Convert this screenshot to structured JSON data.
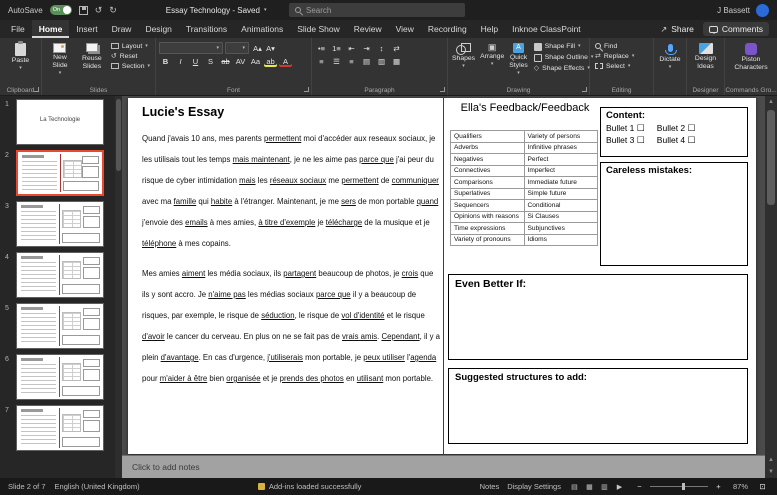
{
  "colors": {
    "accent_selection_red": "#e8492f",
    "slide_separator_red": "#8b1f1f",
    "titlebar_bg": "#1f1f1f",
    "ribbon_bg": "#333333",
    "canvas_bg": "#4b4b4b"
  },
  "titlebar": {
    "autosave_label": "AutoSave",
    "autosave_state": "On",
    "title": "Essay Technology - Saved",
    "search_placeholder": "Search",
    "user_name": "J Bassett"
  },
  "tabs": {
    "items": [
      "File",
      "Home",
      "Insert",
      "Draw",
      "Design",
      "Transitions",
      "Animations",
      "Slide Show",
      "Review",
      "View",
      "Recording",
      "Help",
      "Inknoe ClassPoint"
    ],
    "active": "Home",
    "share": "Share",
    "comments": "Comments"
  },
  "ribbon": {
    "paste": {
      "label": "Paste",
      "group": "Clipboard"
    },
    "slides": {
      "new_slide": "New Slide",
      "reuse_slides": "Reuse Slides",
      "layout": "Layout",
      "reset": "Reset",
      "section": "Section",
      "group": "Slides"
    },
    "font": {
      "group": "Font",
      "row1_buttons": [
        "grow-font",
        "shrink-font"
      ],
      "buttons": [
        "bold",
        "italic",
        "underline",
        "shadow",
        "strikethrough",
        "character-spacing",
        "change-case",
        "highlight-color",
        "font-color"
      ]
    },
    "paragraph": {
      "group": "Paragraph",
      "row1": [
        "bullets",
        "numbering",
        "indent-decrease",
        "indent-increase",
        "line-spacing",
        "text-direction"
      ],
      "row2": [
        "align-left",
        "align-center",
        "align-right",
        "justify",
        "columns",
        "convert-to-smartart"
      ]
    },
    "drawing": {
      "group": "Drawing",
      "shapes": "Shapes",
      "arrange": "Arrange",
      "quick_styles": "Quick Styles",
      "shape_fill": "Shape Fill",
      "shape_outline": "Shape Outline",
      "shape_effects": "Shape Effects"
    },
    "editing": {
      "group": "Editing",
      "find": "Find",
      "replace": "Replace",
      "select": "Select"
    },
    "voice": {
      "dictate": "Dictate"
    },
    "designer": {
      "label": "Design Ideas",
      "group": "Designer"
    },
    "classpoint": {
      "label": "Piston Characters",
      "group": "Commands Gro..."
    }
  },
  "slide_panel": {
    "selected": 2,
    "slides": [
      {
        "n": 1,
        "title": "La Technologie"
      },
      {
        "n": 2
      },
      {
        "n": 3
      },
      {
        "n": 4
      },
      {
        "n": 5
      },
      {
        "n": 6
      },
      {
        "n": 7
      }
    ]
  },
  "slide": {
    "essay_title": "Lucie's Essay",
    "paragraphs": [
      [
        {
          "t": "Quand j'avais 10 ans, mes parents "
        },
        {
          "t": "permettent",
          "u": true
        },
        {
          "t": " moi d'accéder aux reseaux sociaux, je les utilisais tout les temps "
        },
        {
          "t": "mais maintenant",
          "u": true
        },
        {
          "t": ", je ne les aime pas "
        },
        {
          "t": "parce que",
          "u": true
        },
        {
          "t": " j'ai peur du risque de cyber intimidation "
        },
        {
          "t": "mais",
          "u": true
        },
        {
          "t": " les "
        },
        {
          "t": "réseaux sociaux",
          "u": true
        },
        {
          "t": " me "
        },
        {
          "t": "permettent",
          "u": true
        },
        {
          "t": " de "
        },
        {
          "t": "communiquer",
          "u": true
        },
        {
          "t": " avec ma "
        },
        {
          "t": "famille",
          "u": true
        },
        {
          "t": " qui "
        },
        {
          "t": "habite",
          "u": true
        },
        {
          "t": " à l'étranger.  Maintenant, je me "
        },
        {
          "t": "sers",
          "u": true
        },
        {
          "t": " de mon portable "
        },
        {
          "t": "quand",
          "u": true
        },
        {
          "t": " j'envoie des "
        },
        {
          "t": "emails",
          "u": true
        },
        {
          "t": " à mes amies, "
        },
        {
          "t": "à titre d'exemple",
          "u": true
        },
        {
          "t": " je "
        },
        {
          "t": "télécharge",
          "u": true
        },
        {
          "t": " de la musique et je "
        },
        {
          "t": "téléphone",
          "u": true
        },
        {
          "t": " à mes copains."
        }
      ],
      [
        {
          "t": "Mes amies "
        },
        {
          "t": "aiment",
          "u": true
        },
        {
          "t": " les média sociaux, ils "
        },
        {
          "t": "partagent",
          "u": true
        },
        {
          "t": " beaucoup de photos, je "
        },
        {
          "t": "crois",
          "u": true
        },
        {
          "t": " que ils y sont accro. Je "
        },
        {
          "t": "n'aime pas",
          "u": true
        },
        {
          "t": " les médias sociaux "
        },
        {
          "t": "parce que",
          "u": true
        },
        {
          "t": " il y a beaucoup de risques, par exemple, le risque de "
        },
        {
          "t": "séduction",
          "u": true
        },
        {
          "t": ", le risque de "
        },
        {
          "t": "vol d'identité",
          "u": true
        },
        {
          "t": " et le risque "
        },
        {
          "t": "d'avoir",
          "u": true
        },
        {
          "t": " le cancer du cerveau. En plus on ne se fait pas de "
        },
        {
          "t": "vrais amis",
          "u": true
        },
        {
          "t": ". "
        },
        {
          "t": "Cependant",
          "u": true
        },
        {
          "t": ", il y a plein "
        },
        {
          "t": "d'avantage",
          "u": true
        },
        {
          "t": ".  En cas d'urgence, "
        },
        {
          "t": "j'utiliserais",
          "u": true
        },
        {
          "t": " mon portable, je "
        },
        {
          "t": "peux utiliser",
          "u": true
        },
        {
          "t": " l'"
        },
        {
          "t": "agenda",
          "u": true
        },
        {
          "t": " pour "
        },
        {
          "t": "m'aider à être",
          "u": true
        },
        {
          "t": " bien "
        },
        {
          "t": "organisée",
          "u": true
        },
        {
          "t": " et je "
        },
        {
          "t": "prends des photos",
          "u": true
        },
        {
          "t": " en "
        },
        {
          "t": "utilisant",
          "u": true
        },
        {
          "t": " mon portable."
        }
      ]
    ],
    "feedback_title": "Ella's Feedback/Feedback",
    "table_rows": [
      [
        "Qualifiers",
        "Variety of persons"
      ],
      [
        "Adverbs",
        "Infinitive phrases"
      ],
      [
        "Negatives",
        "Perfect"
      ],
      [
        "Connectives",
        "Imperfect"
      ],
      [
        "Comparisons",
        "Immediate future"
      ],
      [
        "Superlatives",
        "Simple future"
      ],
      [
        "Sequencers",
        "Conditional"
      ],
      [
        "Opinions with reasons",
        "Si Clauses"
      ],
      [
        "Time expressions",
        "Subjunctives"
      ],
      [
        "Variety of pronouns",
        "Idioms"
      ]
    ],
    "content_box": {
      "title": "Content:",
      "items": [
        "Bullet 1",
        "Bullet 2",
        "Bullet 3",
        "Bullet 4"
      ]
    },
    "careless_title": "Careless mistakes:",
    "even_better_title": "Even Better If:",
    "suggested_title": "Suggested structures to add:"
  },
  "notes": {
    "placeholder": "Click to add notes"
  },
  "statusbar": {
    "slide_info": "Slide 2 of 7",
    "language": "English (United Kingdom)",
    "addin_status": "Add-ins loaded successfully",
    "notes": "Notes",
    "display_settings": "Display Settings",
    "view_buttons": [
      "normal-view",
      "slide-sorter-view",
      "reading-view",
      "slideshow-view"
    ],
    "zoom": "87%"
  }
}
